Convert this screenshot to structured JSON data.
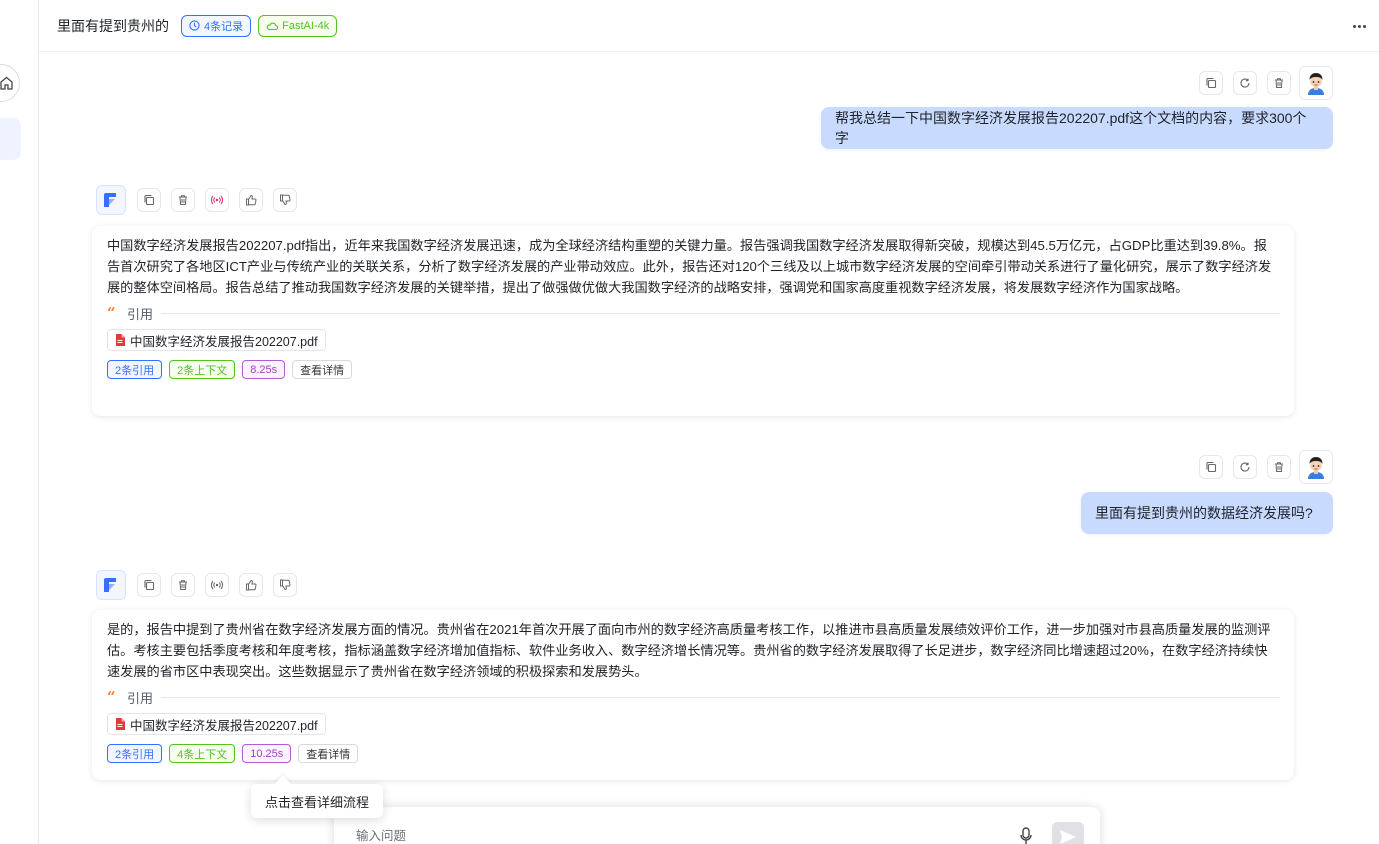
{
  "header": {
    "title": "里面有提到贵州的",
    "records_tag": "4条记录",
    "model_tag": "FastAI-4k"
  },
  "messages": [
    {
      "role": "user",
      "text": "帮我总结一下中国数字经济发展报告202207.pdf这个文档的内容，要求300个字"
    },
    {
      "role": "ai",
      "text": "中国数字经济发展报告202207.pdf指出，近年来我国数字经济发展迅速，成为全球经济结构重塑的关键力量。报告强调我国数字经济发展取得新突破，规模达到45.5万亿元，占GDP比重达到39.8%。报告首次研究了各地区ICT产业与传统产业的关联关系，分析了数字经济发展的产业带动效应。此外，报告还对120个三线及以上城市数字经济发展的空间牵引带动关系进行了量化研究，展示了数字经济发展的整体空间格局。报告总结了推动我国数字经济发展的关键举措，提出了做强做优做大我国数字经济的战略安排，强调党和国家高度重视数字经济发展，将发展数字经济作为国家战略。",
      "quote_label": "引用",
      "file": "中国数字经济发展报告202207.pdf",
      "tags": [
        "2条引用",
        "2条上下文",
        "8.25s",
        "查看详情"
      ]
    },
    {
      "role": "user",
      "text": "里面有提到贵州的数据经济发展吗?"
    },
    {
      "role": "ai",
      "text": "是的，报告中提到了贵州省在数字经济发展方面的情况。贵州省在2021年首次开展了面向市州的数字经济高质量考核工作，以推进市县高质量发展绩效评价工作，进一步加强对市县高质量发展的监测评估。考核主要包括季度考核和年度考核，指标涵盖数字经济增加值指标、软件业务收入、数字经济增长情况等。贵州省的数字经济发展取得了长足进步，数字经济同比增速超过20%，在数字经济持续快速发展的省市区中表现突出。这些数据显示了贵州省在数字经济领域的积极探索和发展势头。",
      "quote_label": "引用",
      "file": "中国数字经济发展报告202207.pdf",
      "tags": [
        "2条引用",
        "4条上下文",
        "10.25s",
        "查看详情"
      ]
    }
  ],
  "tooltip": "点击查看详细流程",
  "input": {
    "placeholder": "输入问题"
  },
  "icons": {
    "records": "clock-icon",
    "model": "cloud-icon",
    "user_tools": [
      "copy-icon",
      "retry-icon",
      "delete-icon"
    ],
    "ai_tools": [
      "copy-icon",
      "delete-icon",
      "speaker-icon",
      "thumbs-up-icon",
      "thumbs-down-icon"
    ],
    "file": "pdf-icon",
    "quote": "quote-icon"
  },
  "colors": {
    "accent": "#3370ff",
    "user_bubble": "#c9daff",
    "green": "#52c41a",
    "purple": "#a03fc9",
    "quote": "#e8833a",
    "pdf": "#e5383b"
  }
}
